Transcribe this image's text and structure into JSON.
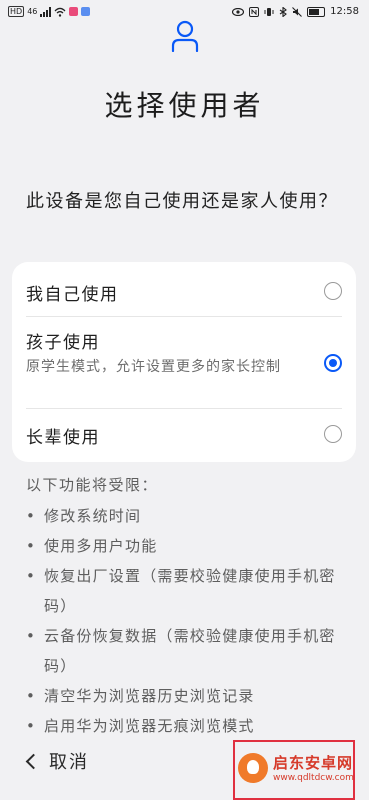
{
  "status_bar": {
    "left_badge": "HD",
    "signal_label": "46",
    "time": "12:58",
    "icons": [
      "signal-icon",
      "wifi-icon",
      "app-notification-icon",
      "eye-icon",
      "nfc-icon",
      "vibrate-icon",
      "bluetooth-icon",
      "mute-icon",
      "battery-icon"
    ]
  },
  "header": {
    "icon": "user-icon",
    "title": "选择使用者"
  },
  "question": "此设备是您自己使用还是家人使用？",
  "options": [
    {
      "label": "我自己使用",
      "description": "",
      "selected": false
    },
    {
      "label": "孩子使用",
      "description": "原学生模式，允许设置更多的家长控制",
      "selected": true
    },
    {
      "label": "长辈使用",
      "description": "",
      "selected": false
    }
  ],
  "restrictions": {
    "title": "以下功能将受限：",
    "items": [
      "修改系统时间",
      "使用多用户功能",
      "恢复出厂设置（需要校验健康使用手机密码）",
      "云备份恢复数据（需校验健康使用手机密码）",
      "清空华为浏览器历史浏览记录",
      "启用华为浏览器无痕浏览模式"
    ]
  },
  "footer": {
    "cancel_label": "取消"
  },
  "watermark": {
    "name": "启东安卓网",
    "url": "www.qdltdcw.com"
  },
  "colors": {
    "accent": "#0a59f7",
    "background": "#f1f1f3",
    "highlight_box": "#e03040"
  }
}
